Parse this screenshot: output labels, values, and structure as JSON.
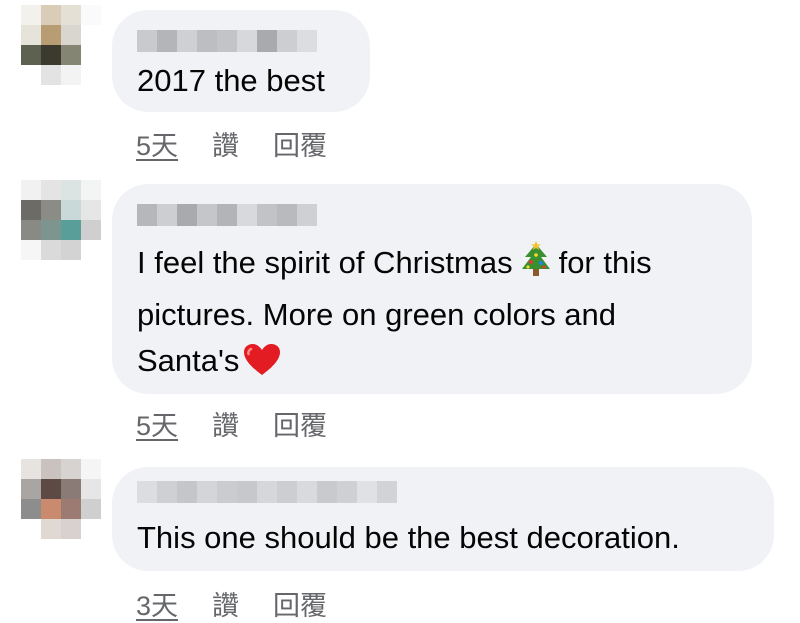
{
  "comments": [
    {
      "text": "2017 the best",
      "time": "5天",
      "like": "讚",
      "reply": "回覆"
    },
    {
      "text_parts": [
        "I feel the spirit of Christmas",
        "for this\npictures. More on green colors and\nSanta's"
      ],
      "emoji_1": "christmas-tree-icon",
      "emoji_2": "red-heart-icon",
      "time": "5天",
      "like": "讚",
      "reply": "回覆"
    },
    {
      "text": "This one should be the best decoration.",
      "time": "3天",
      "like": "讚",
      "reply": "回覆"
    }
  ],
  "colors": {
    "bubble": "#f0f2f5",
    "text": "#050505",
    "meta": "#65676b"
  }
}
